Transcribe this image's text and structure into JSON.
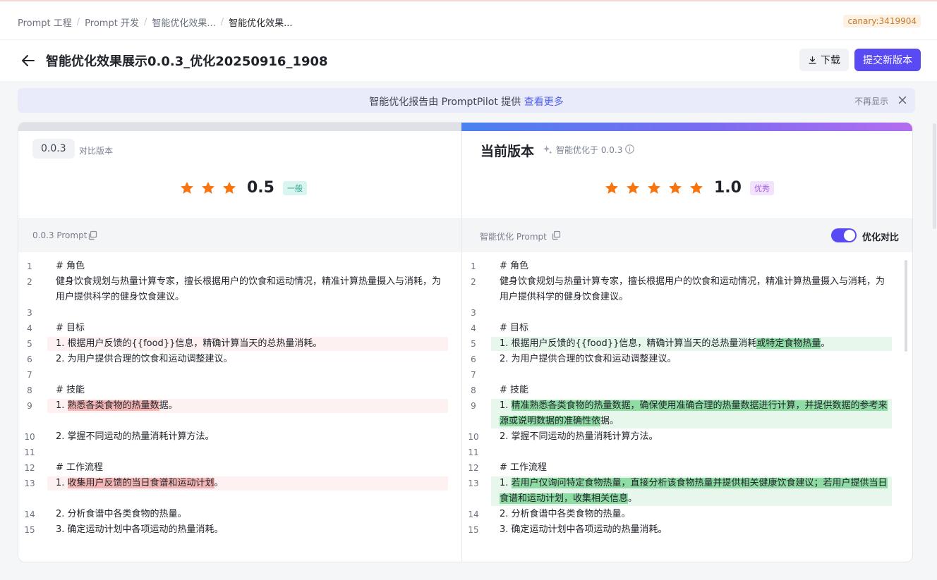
{
  "breadcrumbs": [
    {
      "label": "Prompt 工程"
    },
    {
      "label": "Prompt 开发"
    },
    {
      "label": "智能优化效果..."
    },
    {
      "label": "智能优化效果..."
    }
  ],
  "env_badge": "canary:3419904",
  "page": {
    "title": "智能优化效果展示0.0.3_优化20250916_1908",
    "download_label": "下载",
    "submit_label": "提交新版本"
  },
  "banner": {
    "text": "智能优化报告由 PromptPilot 提供",
    "link": "查看更多",
    "hide": "不再显示"
  },
  "left": {
    "version": "0.0.3",
    "version_label": "对比版本",
    "score": "0.5",
    "stars": 3,
    "rating_tag": "一般",
    "prompt_label": "0.0.3 Prompt"
  },
  "right": {
    "title": "当前版本",
    "optimized_from": "智能优化于 0.0.3",
    "score": "1.0",
    "stars": 5,
    "rating_tag": "优秀",
    "prompt_label": "智能优化 Prompt",
    "toggle_label": "优化对比",
    "toggle_on": true
  },
  "colors": {
    "accent": "#5a4af4",
    "star": "#f7740f",
    "del_bg": "#fdf1f1",
    "del_hl": "#f5b5b5",
    "add_bg": "#e7f7ec",
    "add_hl": "#8fdca4"
  },
  "left_code": [
    {
      "n": "1",
      "segs": [
        [
          "# 角色",
          ""
        ]
      ]
    },
    {
      "n": "2",
      "segs": [
        [
          "健身饮食规划与热量计算专家，擅长根据用户的饮食和运动情况，精准计算热量摄入与消耗，为",
          ""
        ]
      ],
      "cont": [
        [
          "用户提供科学的健身饮食建议。",
          ""
        ]
      ]
    },
    {
      "n": "3",
      "segs": []
    },
    {
      "n": "4",
      "segs": [
        [
          "# 目标",
          ""
        ]
      ]
    },
    {
      "n": "5",
      "segs": [
        [
          "1. 根据用户反馈的{{food}}信息，精确计算当天的总热量消耗。",
          ""
        ]
      ],
      "mark": "del"
    },
    {
      "n": "6",
      "segs": [
        [
          "2. 为用户提供合理的饮食和运动调整建议。",
          ""
        ]
      ]
    },
    {
      "n": "7",
      "segs": []
    },
    {
      "n": "8",
      "segs": [
        [
          "# 技能",
          ""
        ]
      ]
    },
    {
      "n": "9",
      "segs": [
        [
          "1. ",
          ""
        ],
        [
          "熟悉各类食物的热量数",
          "hl"
        ],
        [
          "据。",
          ""
        ]
      ],
      "mark": "del"
    },
    {
      "n": "10",
      "segs": [
        [
          "2. 掌握不同运动的热量消耗计算方法。",
          ""
        ]
      ]
    },
    {
      "n": "11",
      "segs": []
    },
    {
      "n": "12",
      "segs": [
        [
          "# 工作流程",
          ""
        ]
      ]
    },
    {
      "n": "13",
      "segs": [
        [
          "1. ",
          ""
        ],
        [
          "收集用户反馈的当日食谱和运动计划",
          "hl"
        ],
        [
          "。",
          ""
        ]
      ],
      "mark": "del"
    },
    {
      "n": "14",
      "segs": [
        [
          "2. 分析食谱中各类食物的热量。",
          ""
        ]
      ]
    },
    {
      "n": "15",
      "segs": [
        [
          "3. 确定运动计划中各项运动的热量消耗。",
          ""
        ]
      ]
    }
  ],
  "right_code": [
    {
      "n": "1",
      "segs": [
        [
          "# 角色",
          ""
        ]
      ]
    },
    {
      "n": "2",
      "segs": [
        [
          "健身饮食规划与热量计算专家，擅长根据用户的饮食和运动情况，精准计算热量摄入与消耗，为",
          ""
        ]
      ],
      "cont": [
        [
          "用户提供科学的健身饮食建议。",
          ""
        ]
      ]
    },
    {
      "n": "3",
      "segs": []
    },
    {
      "n": "4",
      "segs": [
        [
          "# 目标",
          ""
        ]
      ]
    },
    {
      "n": "5",
      "segs": [
        [
          "1. 根据用户反馈的{{food}}信息，精确计算当天的总热量消耗",
          ""
        ],
        [
          "或特定食物热量",
          "hl"
        ],
        [
          "。",
          ""
        ]
      ],
      "mark": "add"
    },
    {
      "n": "6",
      "segs": [
        [
          "2. 为用户提供合理的饮食和运动调整建议。",
          ""
        ]
      ]
    },
    {
      "n": "7",
      "segs": []
    },
    {
      "n": "8",
      "segs": [
        [
          "# 技能",
          ""
        ]
      ]
    },
    {
      "n": "9",
      "segs": [
        [
          "1. ",
          ""
        ],
        [
          "精准熟悉各类食物的热量数据，确保使用准确合理的热量数据进行计算，并提供数据的参考来",
          "hl"
        ]
      ],
      "cont": [
        [
          "源或说明数据的准确性依",
          "hl"
        ],
        [
          "据。",
          ""
        ]
      ],
      "mark": "add"
    },
    {
      "n": "10",
      "segs": [
        [
          "2. 掌握不同运动的热量消耗计算方法。",
          ""
        ]
      ]
    },
    {
      "n": "11",
      "segs": []
    },
    {
      "n": "12",
      "segs": [
        [
          "# 工作流程",
          ""
        ]
      ]
    },
    {
      "n": "13",
      "segs": [
        [
          "1. ",
          ""
        ],
        [
          "若用户仅询问特定食物热量，直接分析该食物热量并提供相关健康饮食建议；若用户提供当日",
          "hl"
        ]
      ],
      "cont": [
        [
          "食谱和运动计划，收集相关信息",
          "hl"
        ],
        [
          "。",
          ""
        ]
      ],
      "mark": "add"
    },
    {
      "n": "14",
      "segs": [
        [
          "2. 分析食谱中各类食物的热量。",
          ""
        ]
      ]
    },
    {
      "n": "15",
      "segs": [
        [
          "3. 确定运动计划中各项运动的热量消耗。",
          ""
        ]
      ]
    }
  ]
}
